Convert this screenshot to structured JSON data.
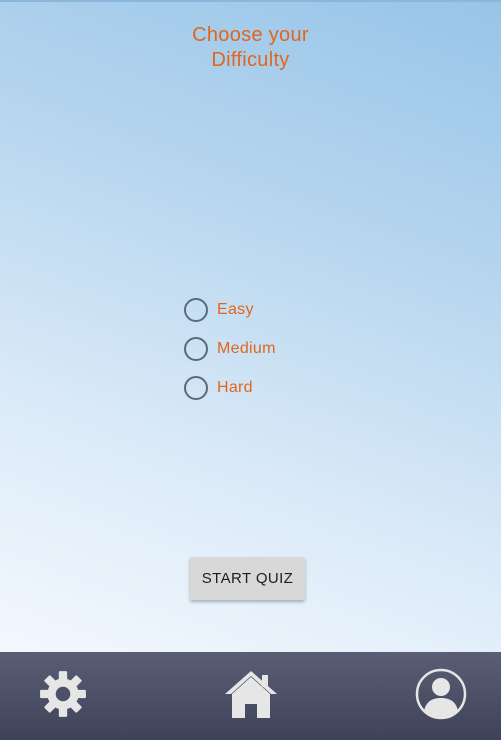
{
  "header": {
    "title_line1": "Choose your",
    "title_line2": "Difficulty"
  },
  "difficulty": {
    "options": [
      {
        "label": "Easy",
        "selected": false
      },
      {
        "label": "Medium",
        "selected": false
      },
      {
        "label": "Hard",
        "selected": false
      }
    ]
  },
  "actions": {
    "start_label": "START QUIZ"
  },
  "bottom_nav": {
    "items": [
      {
        "icon": "gear-icon"
      },
      {
        "icon": "home-icon"
      },
      {
        "icon": "profile-icon"
      }
    ]
  },
  "colors": {
    "accent": "#e0661c",
    "nav_bar": "#4a4e66",
    "icon": "#e6e6e6"
  }
}
